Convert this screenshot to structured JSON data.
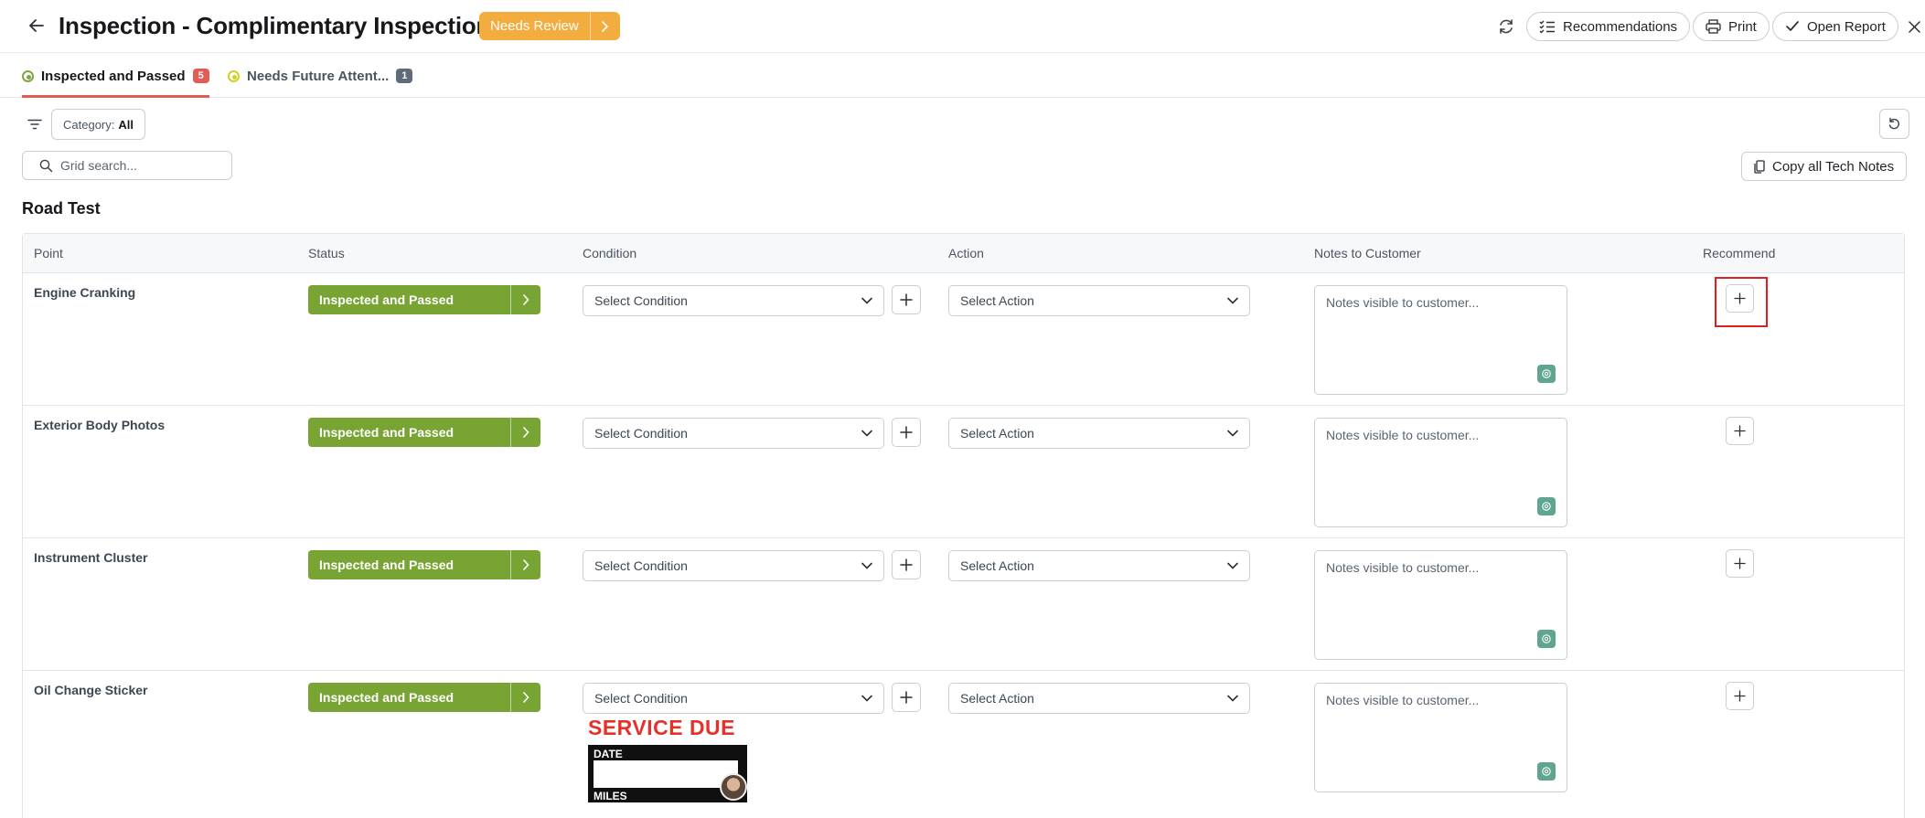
{
  "header": {
    "title": "Inspection - Complimentary Inspection",
    "status_pill": "Needs Review",
    "buttons": {
      "recommendations": "Recommendations",
      "print": "Print",
      "open_report": "Open Report"
    }
  },
  "tabs": [
    {
      "label": "Inspected and Passed",
      "count": "5",
      "active": true,
      "color": "#7ea543"
    },
    {
      "label": "Needs Future Attent...",
      "count": "1",
      "active": false,
      "color": "#d3cf2a"
    }
  ],
  "toolbar": {
    "category_label": "Category:",
    "category_value": "All",
    "search_placeholder": "Grid search...",
    "copy_notes": "Copy all Tech Notes"
  },
  "section": {
    "title": "Road Test"
  },
  "table": {
    "columns": [
      "Point",
      "Status",
      "Condition",
      "Action",
      "Notes to Customer",
      "Recommend"
    ],
    "rows": [
      {
        "point": "Engine Cranking",
        "status": "Inspected and Passed",
        "condition": "Select Condition",
        "action": "Select Action",
        "notes_placeholder": "Notes visible to customer..."
      },
      {
        "point": "Exterior Body Photos",
        "status": "Inspected and Passed",
        "condition": "Select Condition",
        "action": "Select Action",
        "notes_placeholder": "Notes visible to customer..."
      },
      {
        "point": "Instrument Cluster",
        "status": "Inspected and Passed",
        "condition": "Select Condition",
        "action": "Select Action",
        "notes_placeholder": "Notes visible to customer..."
      },
      {
        "point": "Oil Change Sticker",
        "status": "Inspected and Passed",
        "condition": "Select Condition",
        "action": "Select Action",
        "notes_placeholder": "Notes visible to customer..."
      }
    ]
  },
  "sticker": {
    "heading": "SERVICE DUE",
    "date_label": "DATE",
    "miles_label": "MILES"
  },
  "colors": {
    "accent_orange": "#f3ad3f",
    "status_green": "#78a434",
    "tab_underline": "#e25c55",
    "highlight_red": "#e02020"
  }
}
